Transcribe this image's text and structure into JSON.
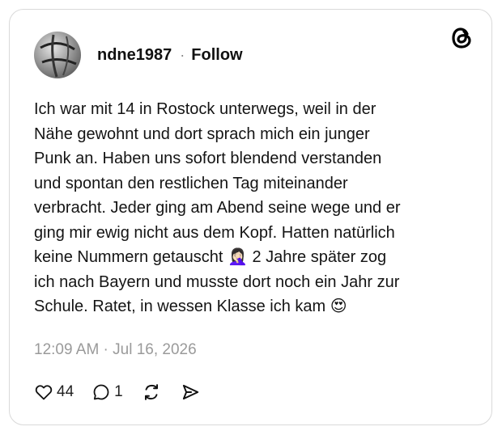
{
  "post": {
    "username": "ndne1987",
    "separator": "·",
    "follow_label": "Follow",
    "text_lines": [
      "Ich war mit 14 in Rostock unterwegs, weil in der",
      "Nähe gewohnt und dort sprach mich ein junger",
      "Punk an. Haben uns sofort blendend verstanden",
      "und spontan den restlichen Tag miteinander",
      "verbracht. Jeder ging am Abend seine wege und er",
      "ging mir ewig nicht aus dem Kopf. Hatten natürlich",
      "keine Nummern getauscht 🤦🏻‍♀️ 2 Jahre später zog",
      "ich nach Bayern und musste dort noch ein Jahr zur",
      "Schule. Ratet, in wessen Klasse ich kam 😍"
    ],
    "timestamp": "12:09 AM · Jul 16, 2026"
  },
  "actions": {
    "likes": "44",
    "replies": "1"
  },
  "icons": {
    "logo": "threads-logo-icon",
    "like": "heart-icon",
    "reply": "comment-icon",
    "repost": "repost-icon",
    "share": "send-icon"
  }
}
